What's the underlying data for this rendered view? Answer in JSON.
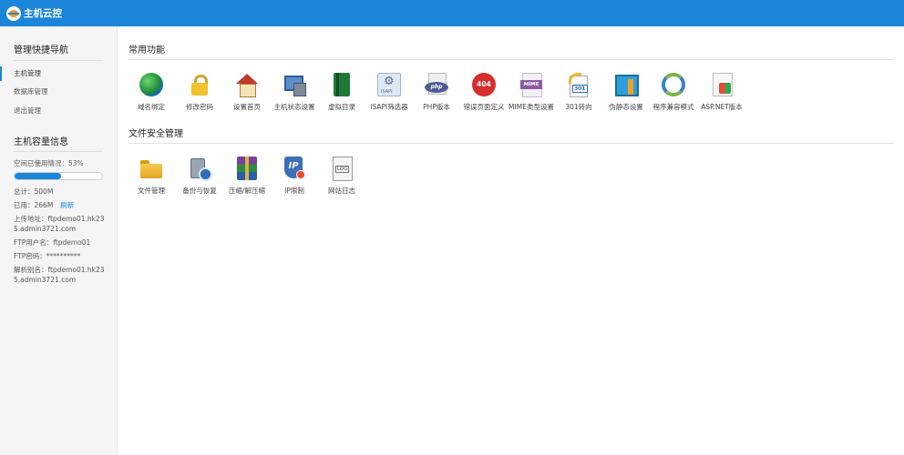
{
  "header": {
    "title": "主机云控"
  },
  "sidebar": {
    "nav_title": "管理快捷导航",
    "nav_items": [
      {
        "label": "主机管理",
        "active": true
      },
      {
        "label": "数据库管理",
        "active": false
      },
      {
        "label": "退出管理",
        "active": false
      }
    ],
    "capacity_title": "主机容量信息",
    "usage_label": "空间已使用情况：53%",
    "usage_percent": 53,
    "total": "总计：500M",
    "used": "已用：266M",
    "refresh": "刷新",
    "upload_address": "上传地址：ftpdemo01.hk235.admin3721.com",
    "ftp_user": "FTP用户名：ftpdemo01",
    "ftp_password": "FTP密码：**********",
    "resolve_alias": "解析别名：ftpdemo01.hk235.admin3721.com"
  },
  "main": {
    "common_title": "常用功能",
    "common_items": [
      {
        "label": "域名绑定",
        "icon": "globe-icon"
      },
      {
        "label": "修改密码",
        "icon": "lock-icon"
      },
      {
        "label": "设置首页",
        "icon": "home-icon"
      },
      {
        "label": "主机状态设置",
        "icon": "server-icon"
      },
      {
        "label": "虚拟目录",
        "icon": "book-icon"
      },
      {
        "label": "ISAPI筛选器",
        "icon": "isapi-gear-icon"
      },
      {
        "label": "PHP版本",
        "icon": "php-icon"
      },
      {
        "label": "错误页面定义",
        "icon": "error-404-icon"
      },
      {
        "label": "MIME类型设置",
        "icon": "mime-icon"
      },
      {
        "label": "301转向",
        "icon": "redirect-301-icon"
      },
      {
        "label": "伪静态设置",
        "icon": "rewrite-icon"
      },
      {
        "label": "程序兼容模式",
        "icon": "refresh-icon"
      },
      {
        "label": "ASP.NET版本",
        "icon": "aspnet-icon"
      }
    ],
    "security_title": "文件安全管理",
    "security_items": [
      {
        "label": "文件管理",
        "icon": "folder-icon"
      },
      {
        "label": "备份与恢复",
        "icon": "backup-icon"
      },
      {
        "label": "压缩/解压缩",
        "icon": "zip-icon"
      },
      {
        "label": "IP限制",
        "icon": "ip-icon"
      },
      {
        "label": "网站日志",
        "icon": "log-icon"
      }
    ]
  },
  "colors": {
    "accent": "#1b86d9",
    "sidebar_bg": "#f5f5f5"
  }
}
